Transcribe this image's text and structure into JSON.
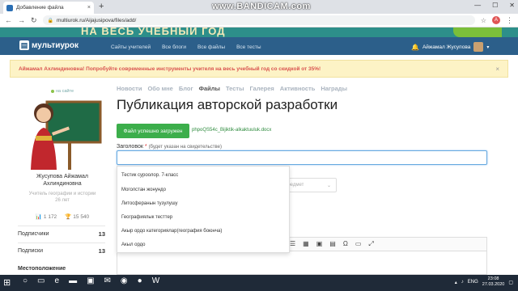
{
  "browser": {
    "tab_title": "Добавление файла",
    "tab_close": "×",
    "new_tab": "+",
    "url": "multiurok.ru/Aijajusipova/files/add/",
    "watermark": "www.BANDICAM.com",
    "icons": {
      "back": "arrow-left-icon",
      "forward": "arrow-right-icon",
      "reload": "reload-icon",
      "lock": "lock-icon",
      "star": "star-icon",
      "menu": "kebab-menu-icon"
    },
    "profile_initial": "A",
    "window_controls": [
      "—",
      "☐",
      "✕"
    ]
  },
  "banner": {
    "text": "НА ВЕСЬ УЧЕБНЫЙ ГОД"
  },
  "site_nav": {
    "logo": "мультиурок",
    "links": [
      "Сайты учителей",
      "Все блоги",
      "Все файлы",
      "Все тесты"
    ],
    "user_name": "Айжамал Жусупова"
  },
  "alert": {
    "text": "Айжамал Ахлиндиновна! Попробуйте современные инструменты учителя на весь учебный год со скидкой от 35%!",
    "close": "×"
  },
  "profile": {
    "status": "на сайте",
    "name": "Жусупова Айжамал Ахлиндиновна",
    "role": "Учитель географии и истории",
    "years": "26 лет",
    "stat_views": "1 172",
    "stat_points": "15 540",
    "rows": [
      {
        "label": "Подписчики",
        "value": "13"
      },
      {
        "label": "Подписки",
        "value": "13"
      }
    ],
    "location_heading": "Местоположение"
  },
  "main": {
    "tabs": [
      "Новости",
      "Обо мне",
      "Блог",
      "Файлы",
      "Тесты",
      "Галерея",
      "Активность",
      "Награды"
    ],
    "active_tab": "Файлы",
    "title": "Публикация авторской разработки",
    "upload_button": "Файл успешно загружен",
    "file_name": "phpoQS54c_Bijiktik-alkaktuuluk.docx",
    "field_label": "Заголовок",
    "field_required": "*",
    "field_hint": "(будет указан на свидетельстве)",
    "select_placeholder": "Предмет",
    "dropdown_items": [
      "Тестик суроолор. 7-класс",
      "Моголстан жонундо",
      "Литосферанын тузулушу",
      "Географиялык тесттер",
      "Акыр ордо категориялар(география боюнча)",
      "Акыл ордо"
    ]
  },
  "taskbar": {
    "lang": "ENG",
    "time": "23:08",
    "date": "27.03.2020"
  }
}
